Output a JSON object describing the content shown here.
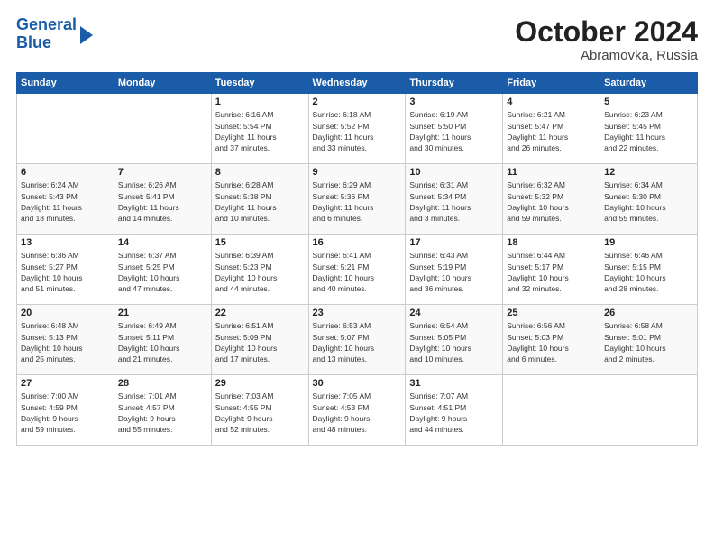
{
  "logo": {
    "line1": "General",
    "line2": "Blue"
  },
  "header": {
    "month": "October 2024",
    "location": "Abramovka, Russia"
  },
  "weekdays": [
    "Sunday",
    "Monday",
    "Tuesday",
    "Wednesday",
    "Thursday",
    "Friday",
    "Saturday"
  ],
  "weeks": [
    [
      {
        "day": "",
        "info": ""
      },
      {
        "day": "",
        "info": ""
      },
      {
        "day": "1",
        "info": "Sunrise: 6:16 AM\nSunset: 5:54 PM\nDaylight: 11 hours\nand 37 minutes."
      },
      {
        "day": "2",
        "info": "Sunrise: 6:18 AM\nSunset: 5:52 PM\nDaylight: 11 hours\nand 33 minutes."
      },
      {
        "day": "3",
        "info": "Sunrise: 6:19 AM\nSunset: 5:50 PM\nDaylight: 11 hours\nand 30 minutes."
      },
      {
        "day": "4",
        "info": "Sunrise: 6:21 AM\nSunset: 5:47 PM\nDaylight: 11 hours\nand 26 minutes."
      },
      {
        "day": "5",
        "info": "Sunrise: 6:23 AM\nSunset: 5:45 PM\nDaylight: 11 hours\nand 22 minutes."
      }
    ],
    [
      {
        "day": "6",
        "info": "Sunrise: 6:24 AM\nSunset: 5:43 PM\nDaylight: 11 hours\nand 18 minutes."
      },
      {
        "day": "7",
        "info": "Sunrise: 6:26 AM\nSunset: 5:41 PM\nDaylight: 11 hours\nand 14 minutes."
      },
      {
        "day": "8",
        "info": "Sunrise: 6:28 AM\nSunset: 5:38 PM\nDaylight: 11 hours\nand 10 minutes."
      },
      {
        "day": "9",
        "info": "Sunrise: 6:29 AM\nSunset: 5:36 PM\nDaylight: 11 hours\nand 6 minutes."
      },
      {
        "day": "10",
        "info": "Sunrise: 6:31 AM\nSunset: 5:34 PM\nDaylight: 11 hours\nand 3 minutes."
      },
      {
        "day": "11",
        "info": "Sunrise: 6:32 AM\nSunset: 5:32 PM\nDaylight: 10 hours\nand 59 minutes."
      },
      {
        "day": "12",
        "info": "Sunrise: 6:34 AM\nSunset: 5:30 PM\nDaylight: 10 hours\nand 55 minutes."
      }
    ],
    [
      {
        "day": "13",
        "info": "Sunrise: 6:36 AM\nSunset: 5:27 PM\nDaylight: 10 hours\nand 51 minutes."
      },
      {
        "day": "14",
        "info": "Sunrise: 6:37 AM\nSunset: 5:25 PM\nDaylight: 10 hours\nand 47 minutes."
      },
      {
        "day": "15",
        "info": "Sunrise: 6:39 AM\nSunset: 5:23 PM\nDaylight: 10 hours\nand 44 minutes."
      },
      {
        "day": "16",
        "info": "Sunrise: 6:41 AM\nSunset: 5:21 PM\nDaylight: 10 hours\nand 40 minutes."
      },
      {
        "day": "17",
        "info": "Sunrise: 6:43 AM\nSunset: 5:19 PM\nDaylight: 10 hours\nand 36 minutes."
      },
      {
        "day": "18",
        "info": "Sunrise: 6:44 AM\nSunset: 5:17 PM\nDaylight: 10 hours\nand 32 minutes."
      },
      {
        "day": "19",
        "info": "Sunrise: 6:46 AM\nSunset: 5:15 PM\nDaylight: 10 hours\nand 28 minutes."
      }
    ],
    [
      {
        "day": "20",
        "info": "Sunrise: 6:48 AM\nSunset: 5:13 PM\nDaylight: 10 hours\nand 25 minutes."
      },
      {
        "day": "21",
        "info": "Sunrise: 6:49 AM\nSunset: 5:11 PM\nDaylight: 10 hours\nand 21 minutes."
      },
      {
        "day": "22",
        "info": "Sunrise: 6:51 AM\nSunset: 5:09 PM\nDaylight: 10 hours\nand 17 minutes."
      },
      {
        "day": "23",
        "info": "Sunrise: 6:53 AM\nSunset: 5:07 PM\nDaylight: 10 hours\nand 13 minutes."
      },
      {
        "day": "24",
        "info": "Sunrise: 6:54 AM\nSunset: 5:05 PM\nDaylight: 10 hours\nand 10 minutes."
      },
      {
        "day": "25",
        "info": "Sunrise: 6:56 AM\nSunset: 5:03 PM\nDaylight: 10 hours\nand 6 minutes."
      },
      {
        "day": "26",
        "info": "Sunrise: 6:58 AM\nSunset: 5:01 PM\nDaylight: 10 hours\nand 2 minutes."
      }
    ],
    [
      {
        "day": "27",
        "info": "Sunrise: 7:00 AM\nSunset: 4:59 PM\nDaylight: 9 hours\nand 59 minutes."
      },
      {
        "day": "28",
        "info": "Sunrise: 7:01 AM\nSunset: 4:57 PM\nDaylight: 9 hours\nand 55 minutes."
      },
      {
        "day": "29",
        "info": "Sunrise: 7:03 AM\nSunset: 4:55 PM\nDaylight: 9 hours\nand 52 minutes."
      },
      {
        "day": "30",
        "info": "Sunrise: 7:05 AM\nSunset: 4:53 PM\nDaylight: 9 hours\nand 48 minutes."
      },
      {
        "day": "31",
        "info": "Sunrise: 7:07 AM\nSunset: 4:51 PM\nDaylight: 9 hours\nand 44 minutes."
      },
      {
        "day": "",
        "info": ""
      },
      {
        "day": "",
        "info": ""
      }
    ]
  ]
}
